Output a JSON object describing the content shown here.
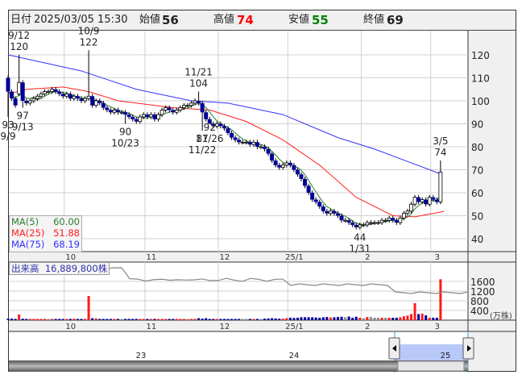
{
  "header": {
    "date_label": "日付",
    "date": "2025/03/05 15:30",
    "open_label": "始値",
    "open": "56",
    "high_label": "高値",
    "high": "74",
    "low_label": "安値",
    "low": "55",
    "close_label": "終値",
    "close": "69"
  },
  "colors": {
    "up_volume": "#ff1a1a",
    "down_volume": "#000099",
    "flat_volume": "#888888",
    "candle_down": "#000099",
    "ma5": "#2e7d2e",
    "ma25": "#ff2020",
    "ma75": "#3333ff",
    "high_value": "#ff0000",
    "low_value": "#008000"
  },
  "ma_legend": [
    {
      "label": "MA(5)",
      "value": "60.00"
    },
    {
      "label": "MA(25)",
      "value": "51.88"
    },
    {
      "label": "MA(75)",
      "value": "68.19"
    }
  ],
  "volume_legend": {
    "label": "出来高",
    "value": "16,889,800株"
  },
  "navigator": {
    "year_labels": [
      "23",
      "24",
      "25"
    ]
  },
  "chart_data": {
    "type": "candlestick",
    "price_axis": {
      "ticks": [
        120,
        110,
        100,
        90,
        80,
        70,
        60,
        50,
        40
      ],
      "range": [
        36,
        130
      ]
    },
    "volume_axis": {
      "ticks": [
        1600,
        1200,
        800,
        400
      ],
      "unit": "(万株)",
      "range": [
        0,
        1800
      ]
    },
    "month_labels": [
      {
        "index": 16,
        "label": "10"
      },
      {
        "index": 38,
        "label": "11"
      },
      {
        "index": 58,
        "label": "12"
      },
      {
        "index": 77,
        "label": "25/1"
      },
      {
        "index": 97,
        "label": "2"
      },
      {
        "index": 116,
        "label": "3"
      }
    ],
    "close": [
      104,
      101,
      98,
      108,
      100,
      99,
      100,
      101,
      102,
      103,
      104,
      104,
      105,
      104,
      103,
      102,
      103,
      101,
      102,
      101,
      100,
      101,
      102,
      98,
      100,
      99,
      97,
      96,
      95,
      96,
      95,
      95,
      94,
      93,
      92,
      91,
      93,
      94,
      93,
      94,
      92,
      94,
      96,
      97,
      96,
      95,
      96,
      97,
      98,
      98,
      99,
      100,
      99,
      95,
      92,
      90,
      89,
      90,
      89,
      88,
      86,
      84,
      83,
      82,
      82,
      82,
      81,
      82,
      80,
      80,
      79,
      77,
      74,
      72,
      71,
      72,
      73,
      72,
      70,
      68,
      66,
      63,
      60,
      57,
      56,
      54,
      52,
      51,
      52,
      51,
      50,
      48,
      48,
      47,
      46,
      45,
      46,
      46,
      47,
      47,
      47,
      47,
      48,
      48,
      49,
      48,
      47,
      49,
      51,
      52,
      55,
      58,
      56,
      57,
      55,
      58,
      57,
      56,
      69
    ],
    "open": [
      110,
      104,
      101,
      103,
      108,
      100,
      99,
      100,
      101,
      102,
      103,
      104,
      104,
      105,
      104,
      103,
      102,
      103,
      101,
      102,
      101,
      100,
      101,
      102,
      98,
      100,
      99,
      97,
      96,
      95,
      96,
      95,
      95,
      94,
      93,
      92,
      91,
      93,
      94,
      93,
      94,
      92,
      94,
      96,
      97,
      96,
      95,
      96,
      97,
      98,
      98,
      99,
      100,
      99,
      95,
      92,
      90,
      89,
      90,
      89,
      88,
      86,
      84,
      83,
      82,
      82,
      82,
      81,
      82,
      80,
      80,
      79,
      77,
      74,
      72,
      71,
      72,
      73,
      72,
      70,
      68,
      66,
      63,
      60,
      57,
      56,
      54,
      52,
      51,
      52,
      51,
      50,
      48,
      48,
      47,
      46,
      45,
      46,
      46,
      47,
      47,
      47,
      47,
      48,
      48,
      49,
      48,
      47,
      49,
      51,
      52,
      55,
      58,
      56,
      57,
      55,
      58,
      57,
      56
    ],
    "volume": [
      60,
      60,
      50,
      230,
      60,
      50,
      50,
      50,
      50,
      50,
      50,
      50,
      50,
      50,
      50,
      50,
      50,
      50,
      60,
      50,
      50,
      50,
      1000,
      80,
      70,
      50,
      50,
      50,
      50,
      50,
      50,
      50,
      50,
      50,
      50,
      50,
      50,
      50,
      50,
      50,
      50,
      50,
      50,
      50,
      50,
      50,
      50,
      50,
      50,
      50,
      50,
      50,
      80,
      60,
      80,
      50,
      50,
      50,
      50,
      50,
      50,
      50,
      50,
      50,
      50,
      50,
      50,
      50,
      50,
      50,
      60,
      70,
      80,
      70,
      60,
      60,
      80,
      100,
      90,
      100,
      120,
      120,
      120,
      120,
      110,
      100,
      120,
      130,
      110,
      120,
      130,
      140,
      120,
      150,
      100,
      140,
      100,
      80,
      130,
      130,
      100,
      100,
      100,
      100,
      100,
      100,
      100,
      120,
      160,
      190,
      250,
      700,
      250,
      270,
      200,
      100,
      100,
      100,
      1690
    ],
    "ma5_note": "computed from close",
    "ma25": [
      [
        0,
        103
      ],
      [
        5,
        105
      ],
      [
        15,
        106
      ],
      [
        22,
        104
      ],
      [
        30,
        100
      ],
      [
        45,
        97
      ],
      [
        55,
        96
      ],
      [
        65,
        91
      ],
      [
        75,
        83
      ],
      [
        85,
        72
      ],
      [
        95,
        58
      ],
      [
        105,
        50
      ],
      [
        111,
        49.5
      ],
      [
        119,
        51.9
      ]
    ],
    "ma75": [
      [
        0,
        120
      ],
      [
        20,
        113
      ],
      [
        35,
        105
      ],
      [
        50,
        100
      ],
      [
        60,
        99
      ],
      [
        75,
        94
      ],
      [
        90,
        84
      ],
      [
        100,
        79
      ],
      [
        110,
        73
      ],
      [
        118,
        68.2
      ]
    ],
    "annotations": [
      {
        "index": 3,
        "date": "9/12",
        "value": 120,
        "kind": "high"
      },
      {
        "index": 22,
        "date": "10/9",
        "value": 122,
        "kind": "high"
      },
      {
        "index": 52,
        "date": "11/21",
        "value": 104,
        "kind": "high"
      },
      {
        "index": 118,
        "date": "3/5",
        "value": 74,
        "kind": "high"
      },
      {
        "index": 0,
        "date": "9/9",
        "value": 93,
        "kind": "low"
      },
      {
        "index": 4,
        "date": "9/13",
        "value": 97,
        "kind": "low"
      },
      {
        "index": 32,
        "date": "10/23",
        "value": 90,
        "kind": "low"
      },
      {
        "index": 53,
        "date": "11/22",
        "value": 87,
        "kind": "low"
      },
      {
        "index": 55,
        "date": "11/26",
        "value": 92,
        "kind": "low"
      },
      {
        "index": 96,
        "date": "1/31",
        "value": 44,
        "kind": "low"
      }
    ]
  }
}
